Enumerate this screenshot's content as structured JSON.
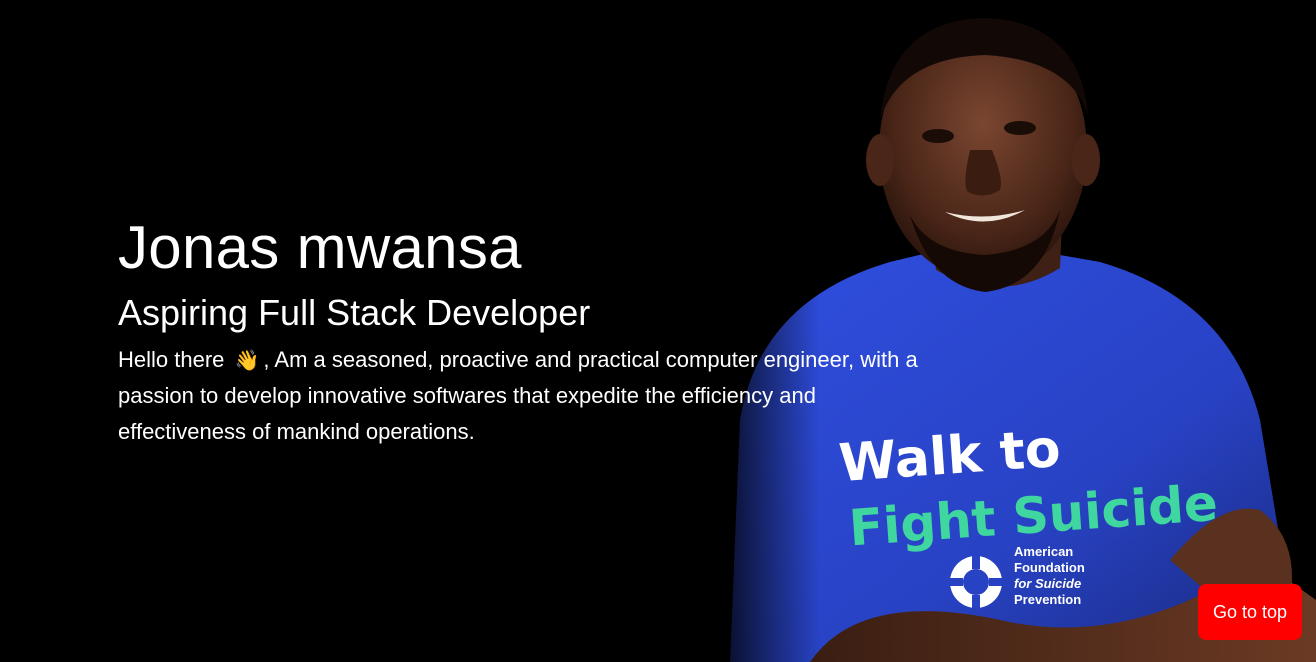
{
  "profile": {
    "name": "Jonas mwansa",
    "role": "Aspiring Full Stack Developer",
    "bio_greeting": "Hello there",
    "bio_emoji": "👋",
    "bio_text": ", Am a seasoned, proactive and practical computer engineer, with a passion to develop innovative softwares that expedite the efficiency and effectiveness of mankind operations."
  },
  "portrait": {
    "shirt_line1": "Walk to",
    "shirt_line2": "Fight Suicide",
    "shirt_org1": "American",
    "shirt_org2": "Foundation",
    "shirt_org3": "for Suicide",
    "shirt_org4": "Prevention"
  },
  "actions": {
    "go_to_top_label": "Go to top"
  },
  "colors": {
    "background": "#000000",
    "text": "#ffffff",
    "button": "#ff0000",
    "shirt": "#2b45c9",
    "shirt_text_top": "#ffffff",
    "shirt_text_bottom": "#3fd6a0"
  }
}
